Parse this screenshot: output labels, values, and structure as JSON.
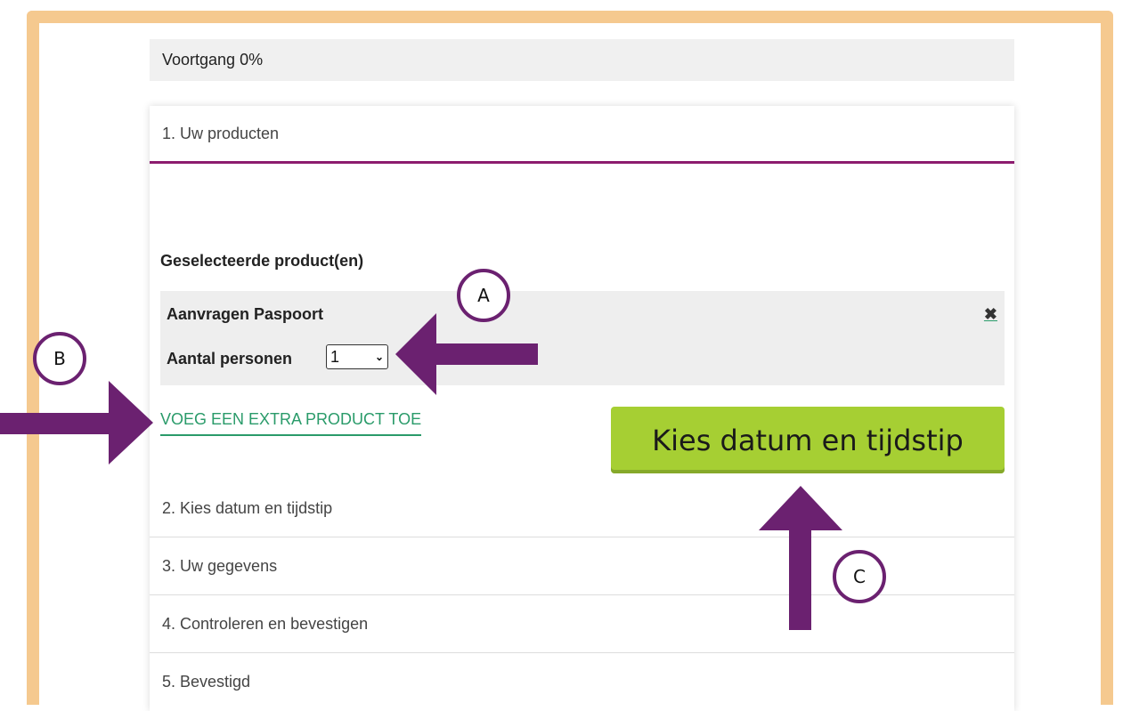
{
  "progress": {
    "label": "Voortgang 0%"
  },
  "steps": [
    {
      "label": "1. Uw producten"
    },
    {
      "label": "2. Kies datum en tijdstip"
    },
    {
      "label": "3. Uw gegevens"
    },
    {
      "label": "4. Controleren en bevestigen"
    },
    {
      "label": "5. Bevestigd"
    }
  ],
  "products": {
    "section_title": "Geselecteerde product(en)",
    "item": {
      "name": "Aanvragen Paspoort",
      "remove_icon": "✖",
      "persons_label": "Aantal personen",
      "persons_value": "1"
    },
    "add_link": "VOEG EEN EXTRA PRODUCT TOE"
  },
  "cta": {
    "label": "Kies datum en tijdstip"
  },
  "annotations": {
    "a": "A",
    "b": "B",
    "c": "C"
  },
  "colors": {
    "frame": "#f5c98f",
    "accent": "#8c1c6e",
    "link": "#2a9b6a",
    "cta": "#a6cf33",
    "arrow": "#6b2170"
  }
}
